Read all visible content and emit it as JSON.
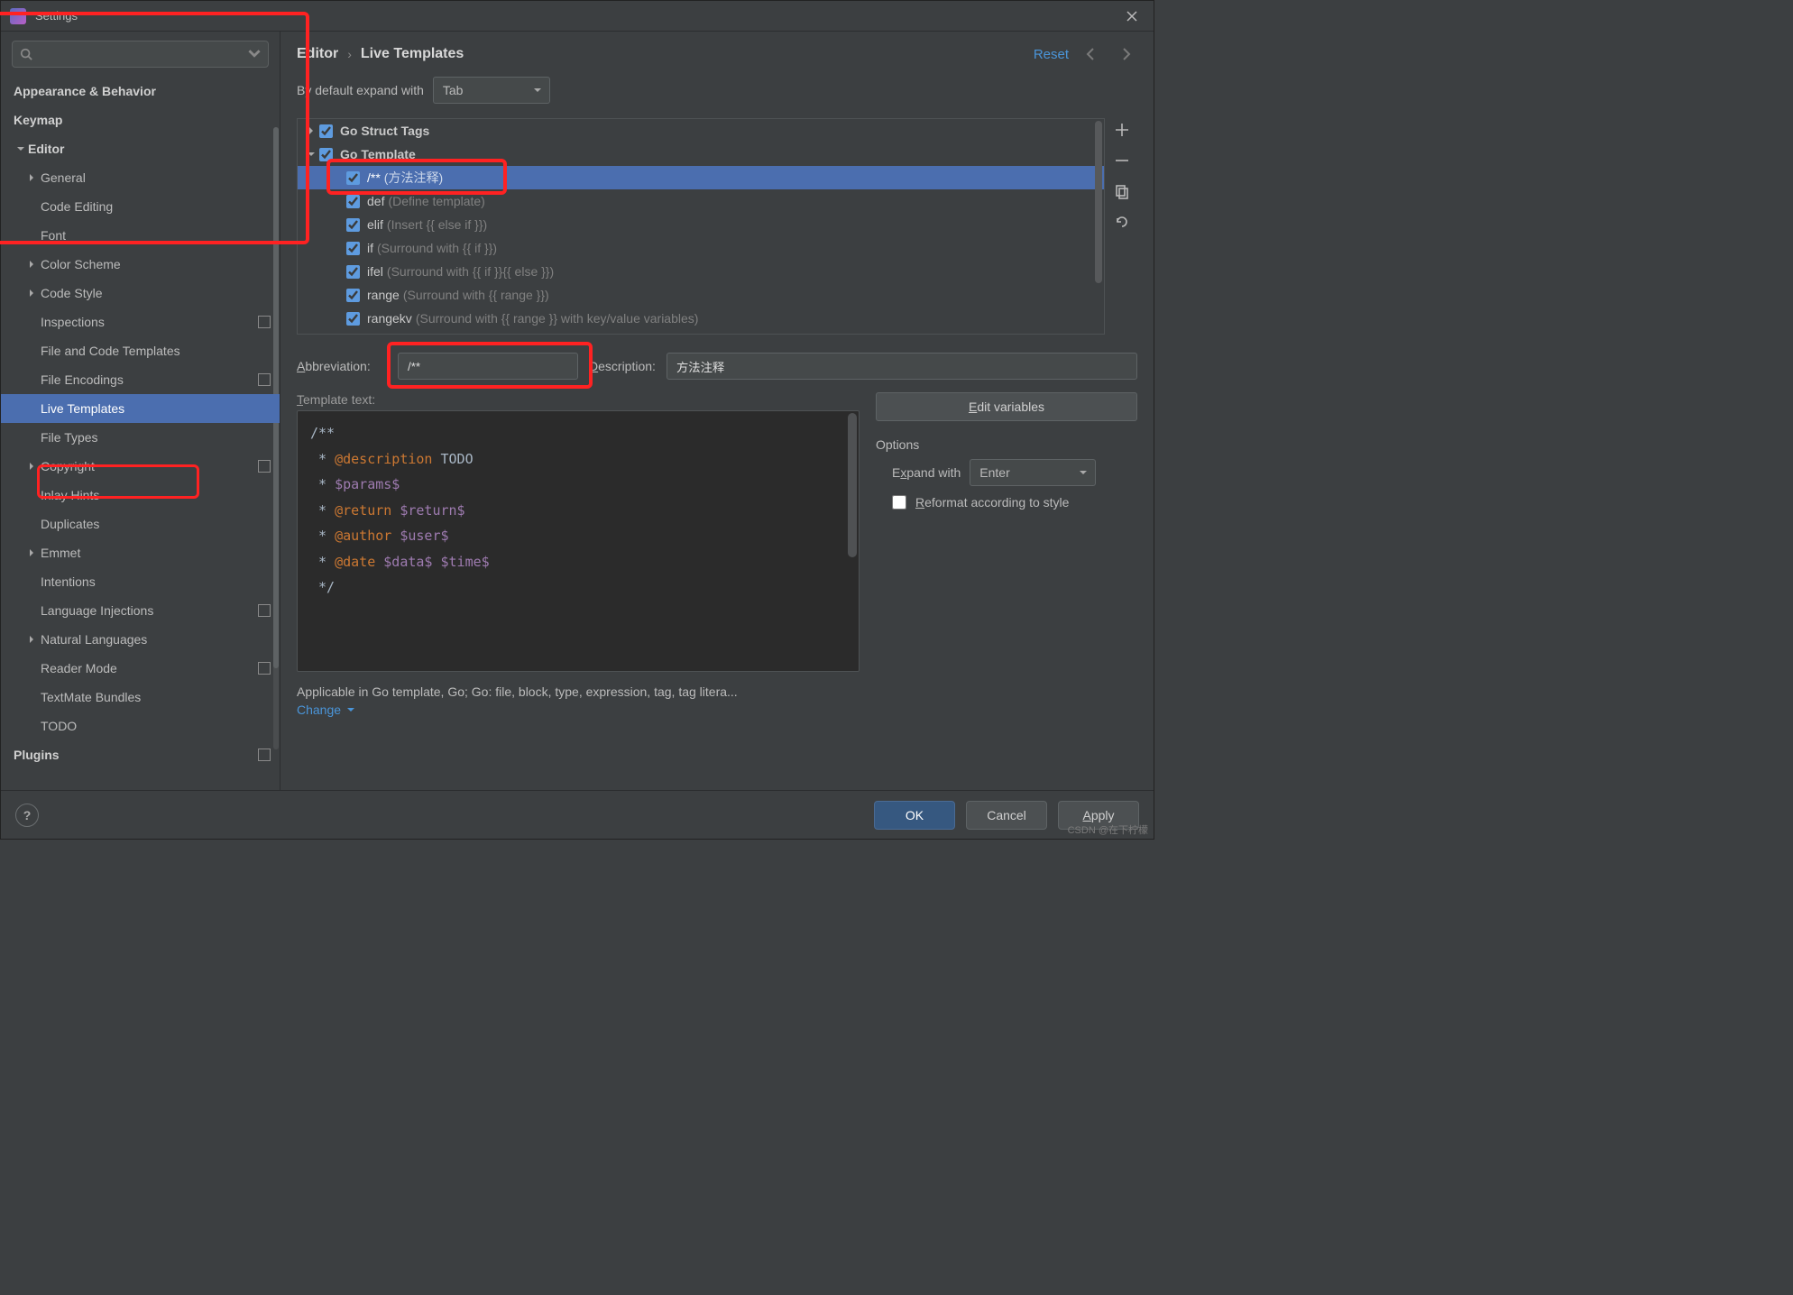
{
  "window": {
    "title": "Settings"
  },
  "sidebar": {
    "search_placeholder": "",
    "items": [
      {
        "label": "Appearance & Behavior",
        "bold": true,
        "level": 0,
        "arrow": ""
      },
      {
        "label": "Keymap",
        "bold": true,
        "level": 0,
        "arrow": ""
      },
      {
        "label": "Editor",
        "bold": true,
        "level": 0,
        "arrow": "down"
      },
      {
        "label": "General",
        "level": 1,
        "arrow": "right"
      },
      {
        "label": "Code Editing",
        "level": 1
      },
      {
        "label": "Font",
        "level": 1
      },
      {
        "label": "Color Scheme",
        "level": 1,
        "arrow": "right"
      },
      {
        "label": "Code Style",
        "level": 1,
        "arrow": "right"
      },
      {
        "label": "Inspections",
        "level": 1,
        "badge": true
      },
      {
        "label": "File and Code Templates",
        "level": 1
      },
      {
        "label": "File Encodings",
        "level": 1,
        "badge": true
      },
      {
        "label": "Live Templates",
        "level": 1,
        "selected": true
      },
      {
        "label": "File Types",
        "level": 1
      },
      {
        "label": "Copyright",
        "level": 1,
        "arrow": "right",
        "badge": true
      },
      {
        "label": "Inlay Hints",
        "level": 1
      },
      {
        "label": "Duplicates",
        "level": 1
      },
      {
        "label": "Emmet",
        "level": 1,
        "arrow": "right"
      },
      {
        "label": "Intentions",
        "level": 1
      },
      {
        "label": "Language Injections",
        "level": 1,
        "badge": true
      },
      {
        "label": "Natural Languages",
        "level": 1,
        "arrow": "right"
      },
      {
        "label": "Reader Mode",
        "level": 1,
        "badge": true
      },
      {
        "label": "TextMate Bundles",
        "level": 1
      },
      {
        "label": "TODO",
        "level": 1
      },
      {
        "label": "Plugins",
        "bold": true,
        "level": 0,
        "badge": true
      }
    ]
  },
  "breadcrumb": {
    "parent": "Editor",
    "current": "Live Templates",
    "reset": "Reset"
  },
  "expand": {
    "label_pre": "By default expand with",
    "value": "Tab"
  },
  "template_groups": [
    {
      "name": "Go Struct Tags",
      "arrow": "right",
      "checked": true
    },
    {
      "name": "Go Template",
      "arrow": "down",
      "checked": true,
      "children": [
        {
          "name": "/**",
          "hint": "(方法注释)",
          "checked": true,
          "selected": true
        },
        {
          "name": "def",
          "hint": "(Define template)",
          "checked": true
        },
        {
          "name": "elif",
          "hint": "(Insert {{ else if }})",
          "checked": true
        },
        {
          "name": "if",
          "hint": "(Surround with {{ if }})",
          "checked": true
        },
        {
          "name": "ifel",
          "hint": "(Surround with {{ if }}{{ else }})",
          "checked": true
        },
        {
          "name": "range",
          "hint": "(Surround with {{ range }})",
          "checked": true
        },
        {
          "name": "rangekv",
          "hint": "(Surround with {{ range }} with key/value variables)",
          "checked": true
        }
      ]
    }
  ],
  "form": {
    "abbrev_label": "Abbreviation:",
    "abbrev_value": "/**",
    "desc_label": "Description:",
    "desc_value": "方法注释",
    "template_text_label": "Template text:",
    "edit_vars": "Edit variables",
    "options_title": "Options",
    "expand_with_label": "Expand with",
    "expand_with_value": "Enter",
    "reformat_label": "Reformat according to style",
    "reformat_checked": false
  },
  "template_code_lines": [
    {
      "segments": [
        {
          "t": "/**",
          "c": "plain"
        }
      ]
    },
    {
      "segments": [
        {
          "t": " * ",
          "c": "plain"
        },
        {
          "t": "@description",
          "c": "kw"
        },
        {
          "t": " TODO",
          "c": "plain"
        }
      ]
    },
    {
      "segments": [
        {
          "t": " * ",
          "c": "plain"
        },
        {
          "t": "$params$",
          "c": "var"
        }
      ]
    },
    {
      "segments": [
        {
          "t": " * ",
          "c": "plain"
        },
        {
          "t": "@return",
          "c": "kw"
        },
        {
          "t": " ",
          "c": "plain"
        },
        {
          "t": "$return$",
          "c": "var"
        }
      ]
    },
    {
      "segments": [
        {
          "t": " * ",
          "c": "plain"
        },
        {
          "t": "@author",
          "c": "kw"
        },
        {
          "t": " ",
          "c": "plain"
        },
        {
          "t": "$user$",
          "c": "var"
        }
      ]
    },
    {
      "segments": [
        {
          "t": " * ",
          "c": "plain"
        },
        {
          "t": "@date",
          "c": "kw"
        },
        {
          "t": " ",
          "c": "plain"
        },
        {
          "t": "$data$",
          "c": "var"
        },
        {
          "t": " ",
          "c": "plain"
        },
        {
          "t": "$time$",
          "c": "var"
        }
      ]
    },
    {
      "segments": [
        {
          "t": " */",
          "c": "plain"
        }
      ]
    }
  ],
  "applicable": {
    "text": "Applicable in Go template, Go; Go: file, block, type, expression, tag, tag litera...",
    "change": "Change"
  },
  "footer": {
    "ok": "OK",
    "cancel": "Cancel",
    "apply": "Apply"
  },
  "watermark": "CSDN @在下柠檬"
}
